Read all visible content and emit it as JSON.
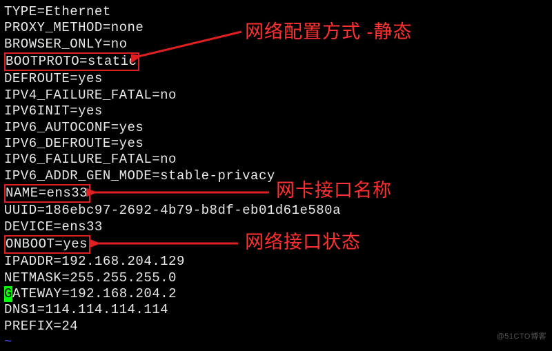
{
  "config": {
    "type": "TYPE=Ethernet",
    "proxy_method": "PROXY_METHOD=none",
    "browser_only": "BROWSER_ONLY=no",
    "bootproto": "BOOTPROTO=static",
    "defroute": "DEFROUTE=yes",
    "ipv4_failure_fatal": "IPV4_FAILURE_FATAL=no",
    "ipv6init": "IPV6INIT=yes",
    "ipv6_autoconf": "IPV6_AUTOCONF=yes",
    "ipv6_defroute": "IPV6_DEFROUTE=yes",
    "ipv6_failure_fatal": "IPV6_FAILURE_FATAL=no",
    "ipv6_addr_gen_mode": "IPV6_ADDR_GEN_MODE=stable-privacy",
    "name": "NAME=ens33",
    "uuid": "UUID=186ebc97-2692-4b79-b8df-eb01d61e580a",
    "device": "DEVICE=ens33",
    "onboot": "ONBOOT=yes",
    "ipaddr": "IPADDR=192.168.204.129",
    "netmask": "NETMASK=255.255.255.0",
    "gateway_first": "G",
    "gateway_rest": "ATEWAY=192.168.204.2",
    "dns1": "DNS1=114.114.114.114",
    "prefix": "PREFIX=24",
    "tilde": "~"
  },
  "annotations": {
    "a1": "网络配置方式 -静态",
    "a2": "网卡接口名称",
    "a3": "网络接口状态"
  },
  "watermark": "@51CTO博客"
}
